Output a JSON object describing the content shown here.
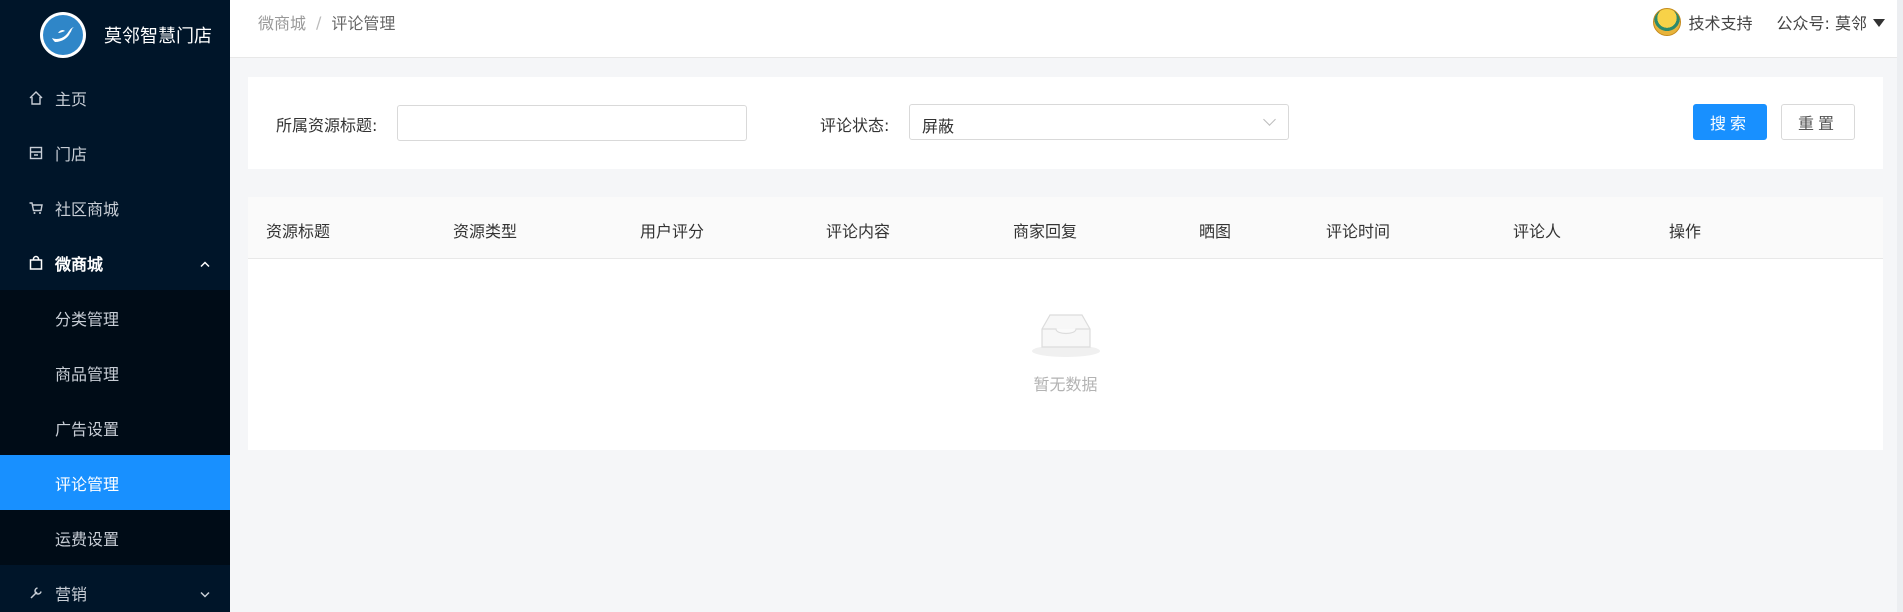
{
  "sidebar": {
    "brand": "莫邻智慧门店",
    "items": [
      {
        "label": "主页"
      },
      {
        "label": "门店"
      },
      {
        "label": "社区商城"
      },
      {
        "label": "微商城"
      }
    ],
    "submenu": [
      {
        "label": "分类管理"
      },
      {
        "label": "商品管理"
      },
      {
        "label": "广告设置"
      },
      {
        "label": "评论管理"
      },
      {
        "label": "运费设置"
      }
    ],
    "after": {
      "label": "营销"
    }
  },
  "header": {
    "breadcrumb": {
      "parent": "微商城",
      "separator": "/",
      "current": "评论管理"
    },
    "support": "技术支持",
    "account": "公众号: 莫邻"
  },
  "filters": {
    "title_label": "所属资源标题:",
    "title_value": "",
    "status_label": "评论状态:",
    "status_value": "屏蔽",
    "search_button": "搜索",
    "reset_button": "重置"
  },
  "table": {
    "columns": [
      "资源标题",
      "资源类型",
      "用户评分",
      "评论内容",
      "商家回复",
      "晒图",
      "评论时间",
      "评论人",
      "操作"
    ],
    "empty_text": "暂无数据"
  },
  "colors": {
    "sidebar_bg": "#001529",
    "submenu_bg": "#000c17",
    "accent": "#1890ff"
  }
}
